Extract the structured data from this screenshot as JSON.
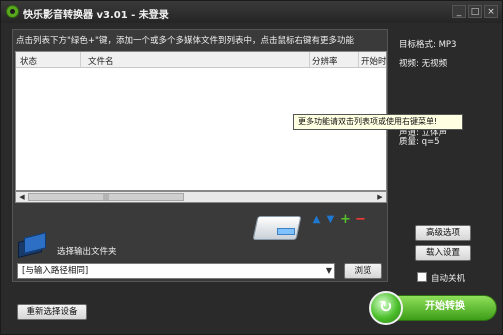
{
  "window": {
    "title": "快乐影音转换器 v3.01 - 未登录",
    "controls": [
      "_",
      "□",
      "×"
    ]
  },
  "main": {
    "hint": "点击列表下方\"绿色+\"键，添加一个或多个多媒体文件到列表中，点击鼠标右键有更多功能",
    "columns": [
      "状态",
      "文件名",
      "分辨率",
      "开始时"
    ]
  },
  "toolbar": {
    "icons": [
      "drive-icon",
      "arrow-up-icon",
      "arrow-down-icon",
      "add-icon",
      "remove-icon"
    ],
    "colors": {
      "up": "#1f78d1",
      "down": "#1f78d1",
      "add": "#55c22b",
      "remove": "#ff3b2f"
    }
  },
  "output": {
    "label": "选择输出文件夹",
    "path_value": "[与输入路径相同]",
    "browse_label": "浏览"
  },
  "info": {
    "format": "目标格式: MP3",
    "video": "视频: 无视频",
    "partial_line1": "P3",
    "partial_line2": "声道: 立体声",
    "partial_line3": "质量: q=5"
  },
  "tooltip": {
    "text": "更多功能请双击列表项或使用右键菜单!"
  },
  "buttons": {
    "advanced": "高级选项",
    "load_settings": "载入设置",
    "auto_shutdown": "自动关机",
    "reset": "重新选择设备",
    "start": "开始转换"
  },
  "colors": {
    "window_bg": "#2a2a2a",
    "panel_bg": "#3a3a3a",
    "accent_green": "#4aa81f"
  }
}
